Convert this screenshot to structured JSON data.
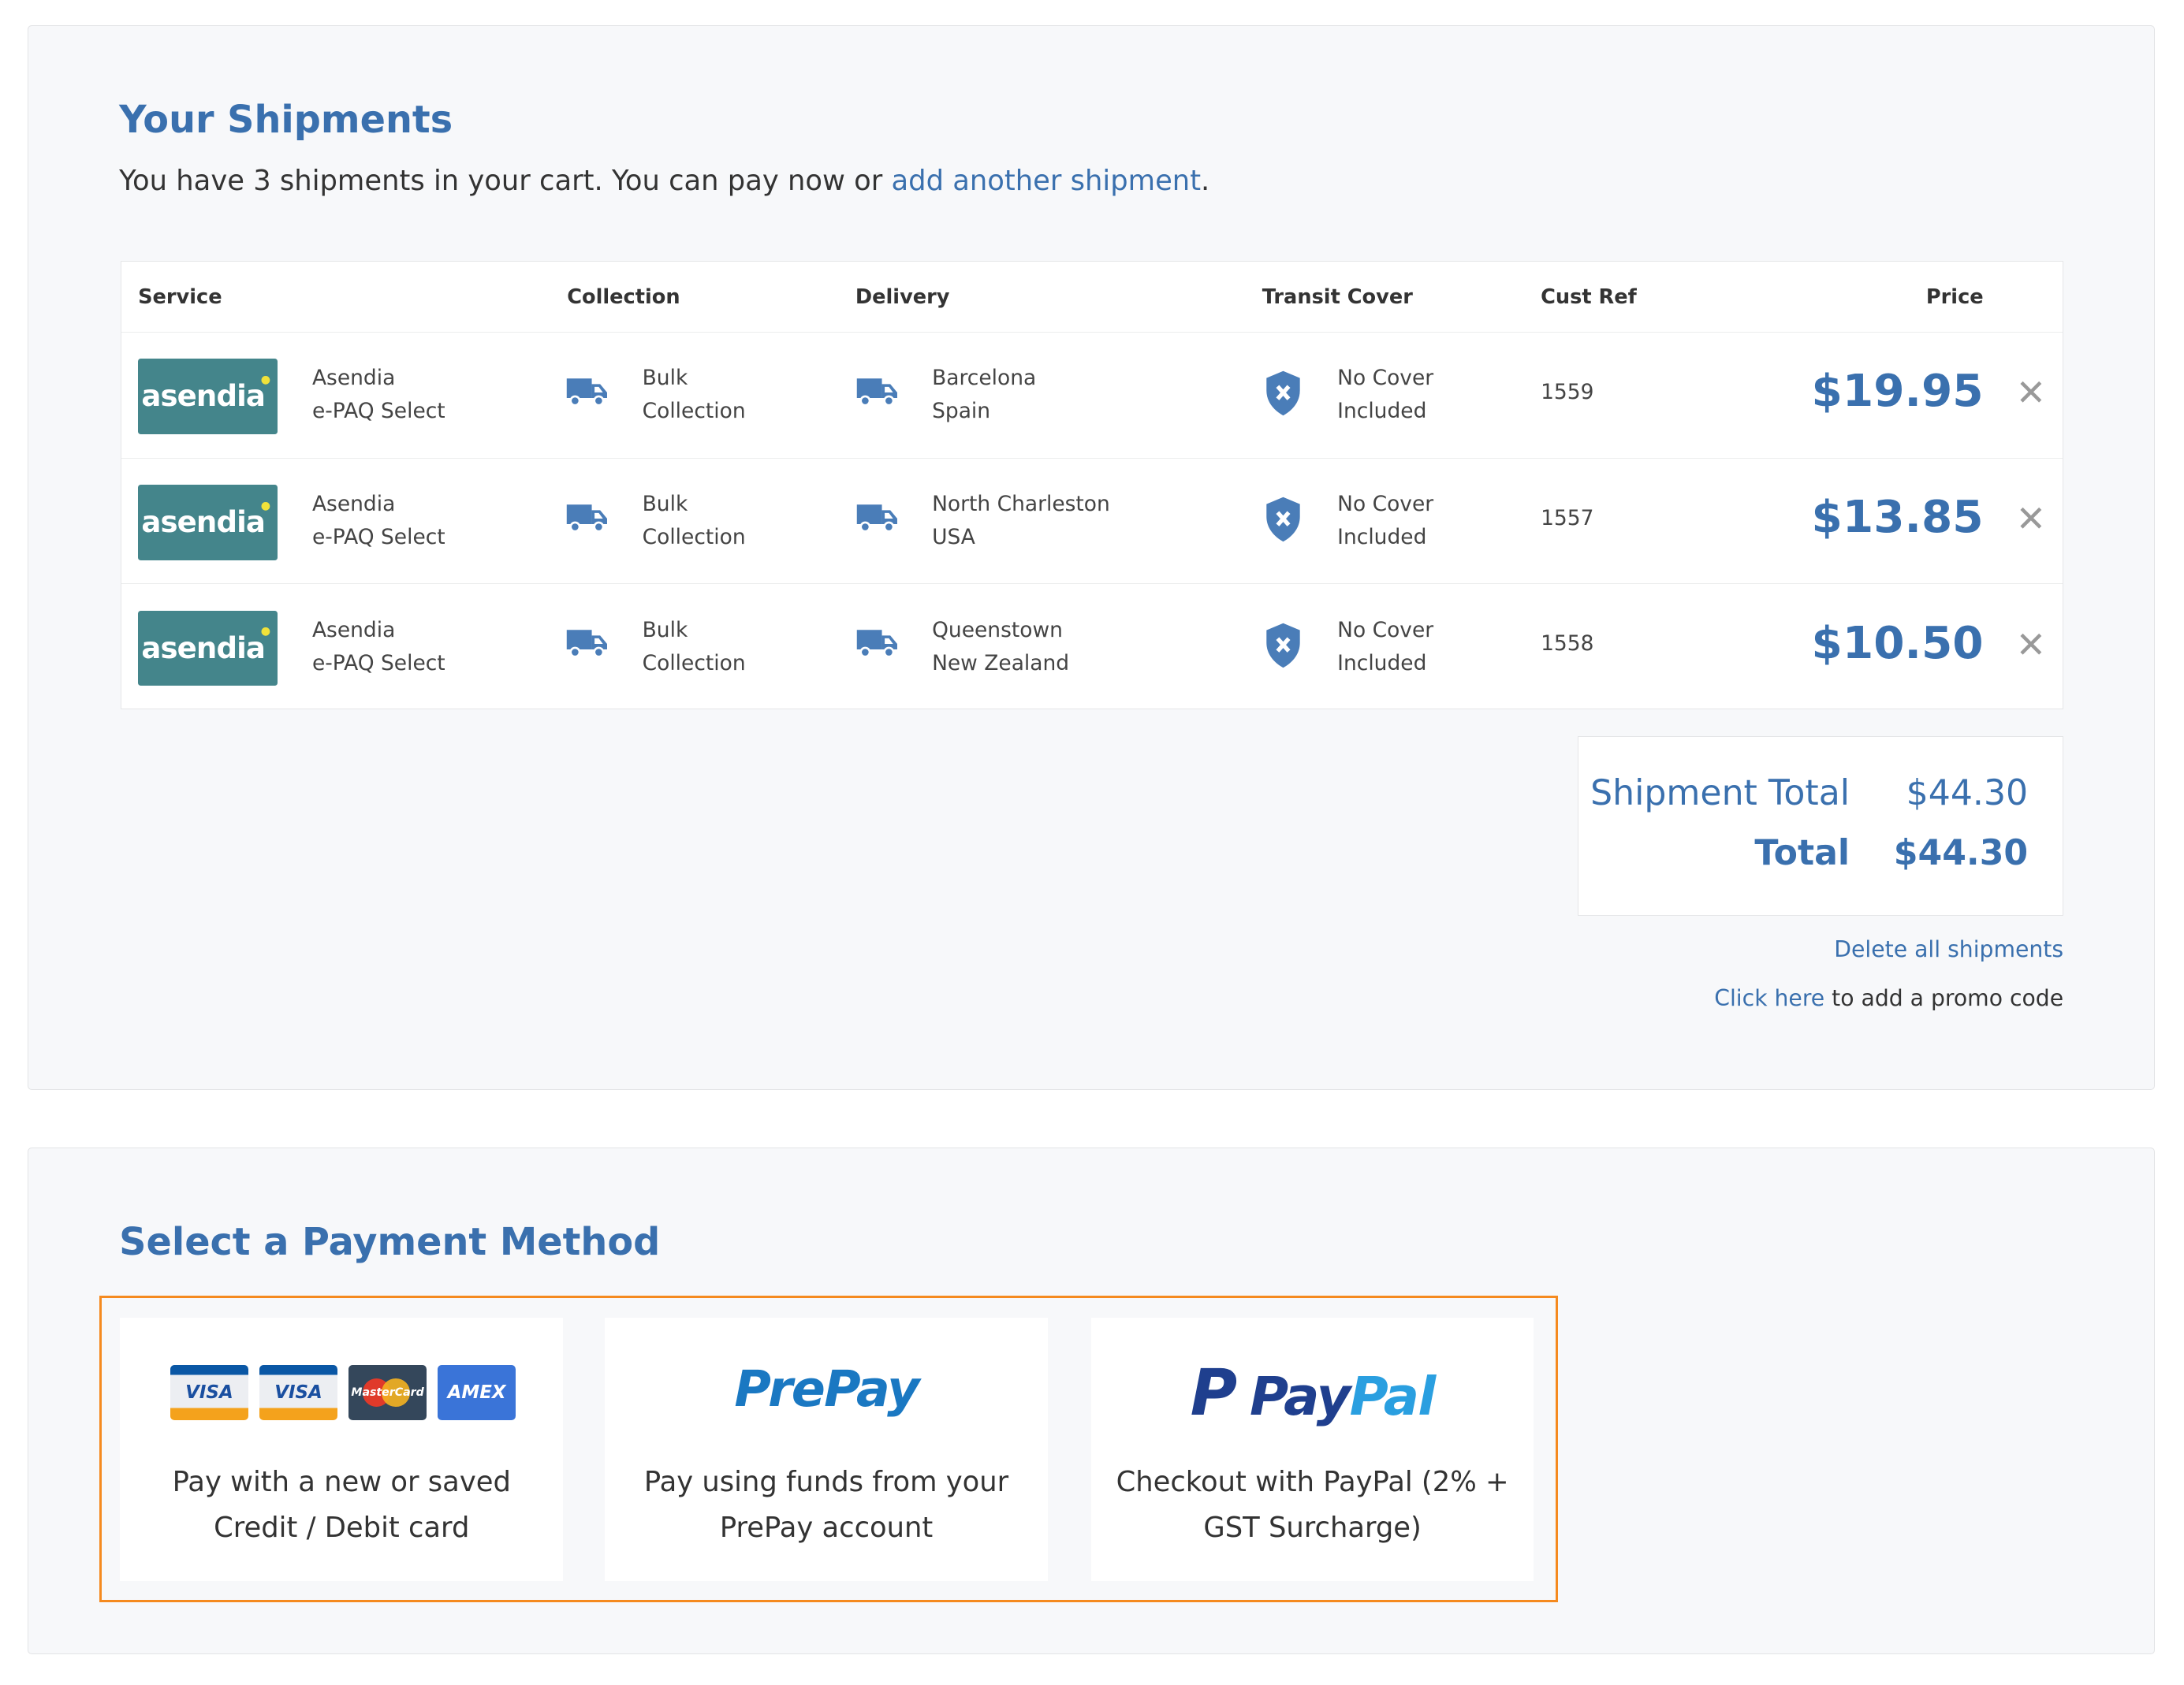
{
  "shipments": {
    "title": "Your Shipments",
    "subtitle_prefix": "You have 3 shipments in your cart. You can pay now or ",
    "subtitle_link": "add another shipment",
    "subtitle_suffix": ".",
    "columns": [
      "Service",
      "Collection",
      "Delivery",
      "Transit Cover",
      "Cust Ref",
      "Price"
    ],
    "rows": [
      {
        "logo": "asendia",
        "service1": "Asendia",
        "service2": "e-PAQ Select",
        "col1": "Bulk",
        "col2": "Collection",
        "del1": "Barcelona",
        "del2": "Spain",
        "cov1": "No Cover",
        "cov2": "Included",
        "ref": "1559",
        "price": "$19.95"
      },
      {
        "logo": "asendia",
        "service1": "Asendia",
        "service2": "e-PAQ Select",
        "col1": "Bulk",
        "col2": "Collection",
        "del1": "North Charleston",
        "del2": "USA",
        "cov1": "No Cover",
        "cov2": "Included",
        "ref": "1557",
        "price": "$13.85"
      },
      {
        "logo": "asendia",
        "service1": "Asendia",
        "service2": "e-PAQ Select",
        "col1": "Bulk",
        "col2": "Collection",
        "del1": "Queenstown",
        "del2": "New Zealand",
        "cov1": "No Cover",
        "cov2": "Included",
        "ref": "1558",
        "price": "$10.50"
      }
    ],
    "remove_icon": "close-icon",
    "totals": {
      "shipment_label": "Shipment Total",
      "shipment_value": "$44.30",
      "total_label": "Total",
      "total_value": "$44.30"
    },
    "delete_all": "Delete all shipments",
    "promo_link": "Click here",
    "promo_text": " to add a promo code"
  },
  "payment": {
    "title": "Select a Payment Method",
    "methods": [
      {
        "logos": [
          "VISA",
          "VISA",
          "MasterCard",
          "AMEX"
        ],
        "debit": "Debit",
        "line1": "Pay with a new or saved",
        "line2": "Credit / Debit card"
      },
      {
        "logo": "PrePay",
        "line1": "Pay using funds from your",
        "line2": "PrePay account"
      },
      {
        "logo_a": "Pay",
        "logo_b": "Pal",
        "line1": "Checkout with PayPal (2% +",
        "line2": "GST Surcharge)"
      }
    ],
    "highlight_color": "#f58a1f"
  },
  "colors": {
    "accent": "#3a70ae",
    "asendia": "#44858b"
  }
}
